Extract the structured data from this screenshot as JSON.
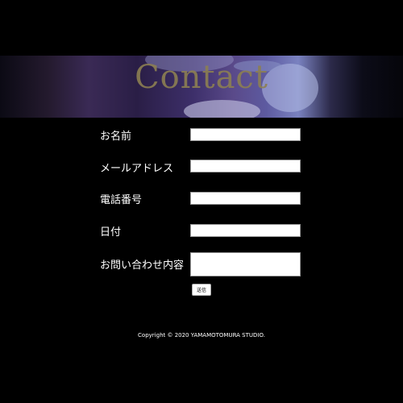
{
  "hero": {
    "title": "Contact"
  },
  "form": {
    "fields": [
      {
        "label": "お名前",
        "value": ""
      },
      {
        "label": "メールアドレス",
        "value": ""
      },
      {
        "label": "電話番号",
        "value": ""
      },
      {
        "label": "日付",
        "value": ""
      },
      {
        "label": "お問い合わせ内容",
        "value": ""
      }
    ],
    "submit_label": "送信"
  },
  "footer": {
    "copyright": "Copyright © 2020 YAMAMOTOMURA STUDIO."
  }
}
